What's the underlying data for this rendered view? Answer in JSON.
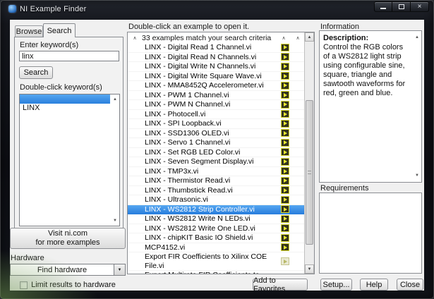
{
  "titlebar": {
    "title": "NI Example Finder"
  },
  "icons": {
    "close": "×",
    "sort": "∧",
    "up": "▲",
    "down": "▼",
    "dropdown": "▼"
  },
  "left_panel": {
    "tabs": [
      {
        "label": "Browse",
        "active": false
      },
      {
        "label": "Search",
        "active": true
      }
    ],
    "keyword_label": "Enter keyword(s)",
    "keyword_value": "linx",
    "search_button": "Search",
    "keyword_list_label": "Double-click keyword(s)",
    "keyword_rows": [
      {
        "label": "",
        "selected": true
      },
      {
        "label": "LINX",
        "selected": false
      }
    ],
    "visit_button_line1": "Visit ni.com",
    "visit_button_line2": "for more examples",
    "hardware_label": "Hardware",
    "hardware_dropdown_value": "Find hardware",
    "limit_checkbox_label": "Limit results to hardware",
    "limit_checkbox_checked": false
  },
  "results_panel": {
    "instruction": "Double-click an example to open it.",
    "header": "33 examples match your search criteria",
    "items": [
      {
        "label": "LINX - Digital Read 1 Channel.vi",
        "icon": "vi",
        "selected": false,
        "dim": false
      },
      {
        "label": "LINX - Digital Read N Channels.vi",
        "icon": "vi",
        "selected": false,
        "dim": false
      },
      {
        "label": "LINX - Digital Write N Channels.vi",
        "icon": "vi",
        "selected": false,
        "dim": false
      },
      {
        "label": "LINX - Digital Write Square Wave.vi",
        "icon": "vi",
        "selected": false,
        "dim": false
      },
      {
        "label": "LINX - MMA8452Q Accelerometer.vi",
        "icon": "vi",
        "selected": false,
        "dim": false
      },
      {
        "label": "LINX - PWM 1 Channel.vi",
        "icon": "vi",
        "selected": false,
        "dim": false
      },
      {
        "label": "LINX - PWM N Channel.vi",
        "icon": "vi",
        "selected": false,
        "dim": false
      },
      {
        "label": "LINX - Photocell.vi",
        "icon": "vi",
        "selected": false,
        "dim": false
      },
      {
        "label": "LINX - SPI Loopback.vi",
        "icon": "vi",
        "selected": false,
        "dim": false
      },
      {
        "label": "LINX - SSD1306 OLED.vi",
        "icon": "vi",
        "selected": false,
        "dim": false
      },
      {
        "label": "LINX - Servo 1 Channel.vi",
        "icon": "vi",
        "selected": false,
        "dim": false
      },
      {
        "label": "LINX - Set RGB LED Color.vi",
        "icon": "vi",
        "selected": false,
        "dim": false
      },
      {
        "label": "LINX - Seven Segment Display.vi",
        "icon": "vi",
        "selected": false,
        "dim": false
      },
      {
        "label": "LINX - TMP3x.vi",
        "icon": "vi",
        "selected": false,
        "dim": false
      },
      {
        "label": "LINX - Thermistor Read.vi",
        "icon": "vi",
        "selected": false,
        "dim": false
      },
      {
        "label": "LINX - Thumbstick Read.vi",
        "icon": "vi",
        "selected": false,
        "dim": false
      },
      {
        "label": "LINX - Ultrasonic.vi",
        "icon": "vi",
        "selected": false,
        "dim": false
      },
      {
        "label": "LINX - WS2812 Strip Controller.vi",
        "icon": "vi",
        "selected": true,
        "dim": false
      },
      {
        "label": "LINX - WS2812 Write N LEDs.vi",
        "icon": "vi",
        "selected": false,
        "dim": false
      },
      {
        "label": "LINX - WS2812 Write One LED.vi",
        "icon": "vi",
        "selected": false,
        "dim": false
      },
      {
        "label": "LINX - chipKIT Basic IO Shield.vi",
        "icon": "vi",
        "selected": false,
        "dim": false
      },
      {
        "label": "MCP4152.vi",
        "icon": "vi",
        "selected": false,
        "dim": false
      },
      {
        "label": "Export FIR Coefficients to Xilinx COE File.vi",
        "icon": "vi",
        "selected": false,
        "dim": true
      },
      {
        "label": "Export Multirate FIR Coefficients to Xilinx COE File.vi",
        "icon": "vi",
        "selected": false,
        "dim": true
      }
    ],
    "add_to_favorites": "Add to Favorites"
  },
  "info_panel": {
    "information_label": "Information",
    "description_title": "Description:",
    "description_text": "Control the RGB colors of a WS2812 light strip using configurable sine, square, triangle and sawtooth waveforms for red, green and blue.",
    "requirements_label": "Requirements",
    "buttons": [
      "Setup...",
      "Help",
      "Close"
    ]
  }
}
